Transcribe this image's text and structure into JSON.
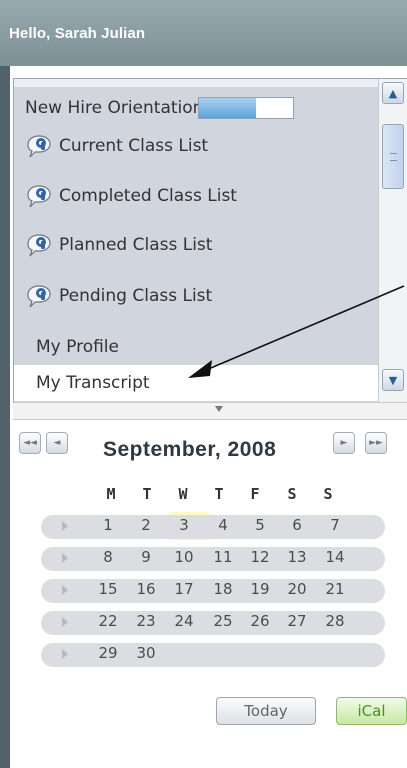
{
  "header": {
    "greeting": "Hello, Sarah Julian"
  },
  "menu": {
    "items": [
      {
        "label": "New Hire Orientation",
        "icon": "none",
        "progress": 0.6
      },
      {
        "label": "Current Class List",
        "icon": "chat-bubble-icon"
      },
      {
        "label": "Completed Class List",
        "icon": "chat-bubble-icon"
      },
      {
        "label": "Planned Class List",
        "icon": "chat-bubble-icon"
      },
      {
        "label": "Pending Class List",
        "icon": "chat-bubble-icon"
      },
      {
        "label": "My Profile",
        "icon": "none"
      },
      {
        "label": "My Transcript",
        "icon": "none",
        "selected": true
      }
    ],
    "scroll_up": "▲",
    "scroll_down": "▼"
  },
  "calendar": {
    "month_title": "September, 2008",
    "nav": {
      "first": "◄◄",
      "prev": "◄",
      "next": "►",
      "last": "►►"
    },
    "days_of_week": [
      "M",
      "T",
      "W",
      "T",
      "F",
      "S",
      "S"
    ],
    "weeks": [
      [
        "1",
        "2",
        "3",
        "4",
        "5",
        "6",
        "7"
      ],
      [
        "8",
        "9",
        "10",
        "11",
        "12",
        "13",
        "14"
      ],
      [
        "15",
        "16",
        "17",
        "18",
        "19",
        "20",
        "21"
      ],
      [
        "22",
        "23",
        "24",
        "25",
        "26",
        "27",
        "28"
      ],
      [
        "29",
        "30",
        "",
        "",
        "",
        "",
        ""
      ]
    ],
    "highlighted_day": "3",
    "today_label": "Today",
    "ical_label": "iCal"
  },
  "colors": {
    "header_bg": "#8da0a6",
    "menu_bg": "#d0d5de",
    "highlight_day": "#fdfbc1",
    "ical_green": "#4f8b2a"
  }
}
